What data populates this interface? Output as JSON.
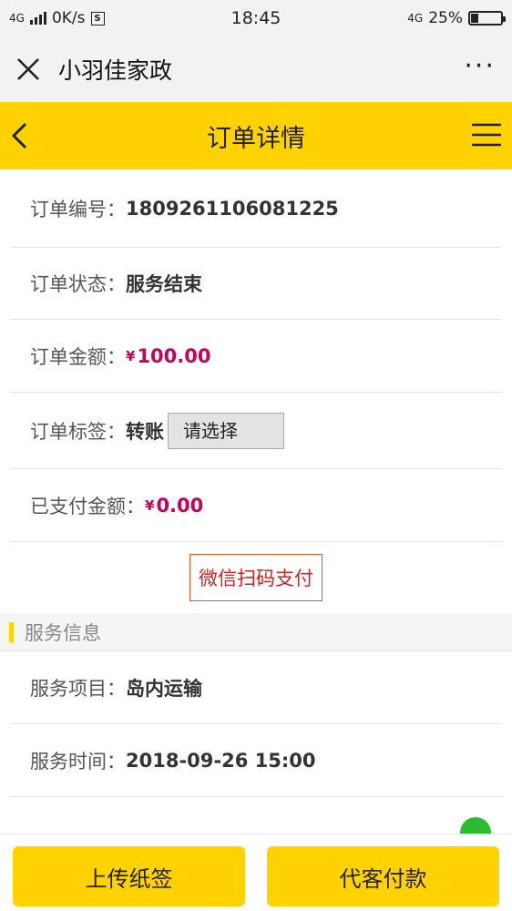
{
  "statusbar": {
    "network": "4G",
    "speed": "0K/s",
    "s_icon": "S",
    "time": "18:45",
    "network2": "4G",
    "battery": "25%"
  },
  "wechat": {
    "title": "小羽佳家政",
    "more": "···"
  },
  "navbar": {
    "title": "订单详情"
  },
  "order": {
    "number_label": "订单编号：",
    "number": "1809261106081225",
    "status_label": "订单状态：",
    "status": "服务结束",
    "amount_label": "订单金额：",
    "amount_currency": "¥",
    "amount": "100.00",
    "tag_label": "订单标签：",
    "tag": "转账",
    "tag_select": "请选择",
    "paid_label": "已支付金额：",
    "paid_currency": "¥",
    "paid": "0.00",
    "pay_button": "微信扫码支付"
  },
  "service": {
    "section_title": "服务信息",
    "item_label": "服务项目：",
    "item": "岛内运输",
    "time_label": "服务时间：",
    "time": "2018-09-26 15:00"
  },
  "footer": {
    "upload_label": "上传纸签",
    "pay_label": "代客付款"
  },
  "colors": {
    "accent": "#ffd200",
    "money": "#c8005a",
    "pay_border": "#e8541d"
  }
}
